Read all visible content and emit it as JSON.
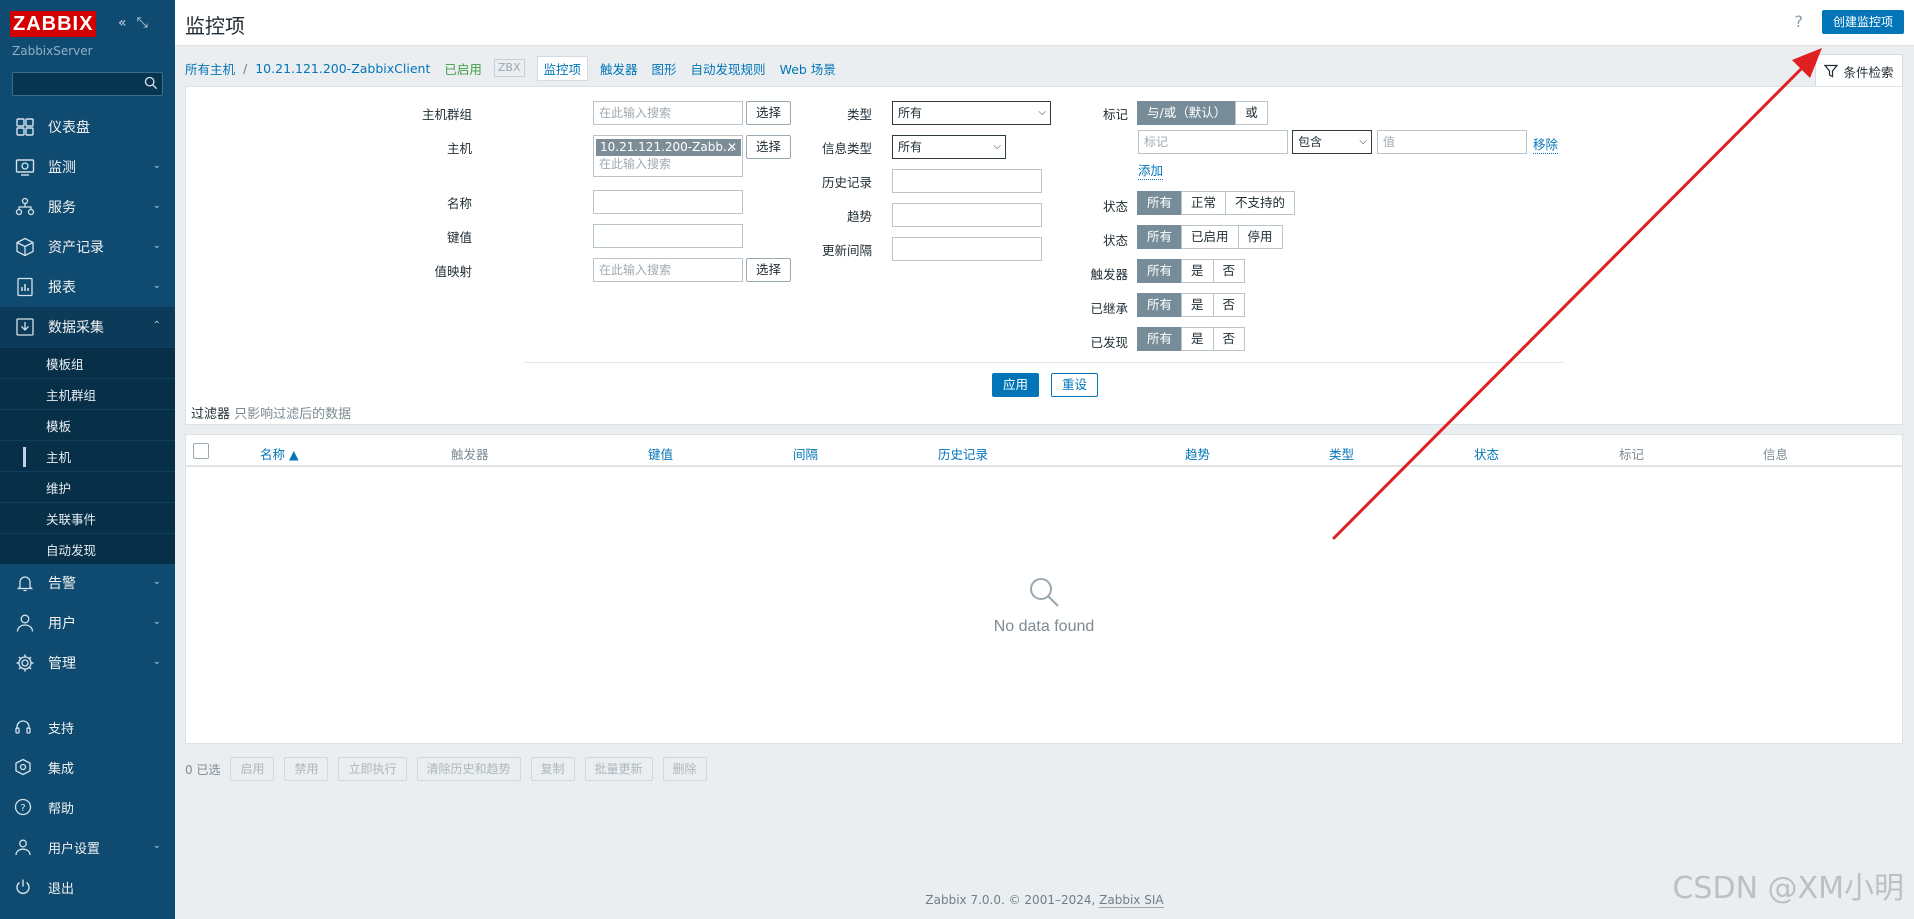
{
  "sidebar": {
    "logo": "ZABBIX",
    "server": "ZabbixServer",
    "main_items": [
      {
        "label": "仪表盘",
        "icon": "dashboard-icon"
      },
      {
        "label": "监测",
        "icon": "monitoring-icon"
      },
      {
        "label": "服务",
        "icon": "services-icon"
      },
      {
        "label": "资产记录",
        "icon": "inventory-icon"
      },
      {
        "label": "报表",
        "icon": "reports-icon"
      },
      {
        "label": "数据采集",
        "icon": "data-collection-icon"
      }
    ],
    "sub_items": [
      "模板组",
      "主机群组",
      "模板",
      "主机",
      "维护",
      "关联事件",
      "自动发现"
    ],
    "lower_items": [
      {
        "label": "告警",
        "icon": "alerts-icon"
      },
      {
        "label": "用户",
        "icon": "users-icon"
      },
      {
        "label": "管理",
        "icon": "admin-icon"
      }
    ],
    "bottom_items": [
      {
        "label": "支持",
        "icon": "support-icon"
      },
      {
        "label": "集成",
        "icon": "integrations-icon"
      },
      {
        "label": "帮助",
        "icon": "help-icon"
      },
      {
        "label": "用户设置",
        "icon": "user-settings-icon"
      },
      {
        "label": "退出",
        "icon": "signout-icon"
      }
    ]
  },
  "header": {
    "title": "监控项",
    "help": "?",
    "create_button": "创建监控项"
  },
  "breadcrumbs": {
    "all_hosts": "所有主机",
    "separator": "/",
    "host": "10.21.121.200-ZabbixClient",
    "enabled": "已启用",
    "zbx": "ZBX",
    "tabs": [
      "监控项",
      "触发器",
      "图形",
      "自动发现规则",
      "Web 场景"
    ]
  },
  "filter_tab": "条件检索",
  "filter": {
    "host_group_label": "主机群组",
    "host_label": "主机",
    "name_label": "名称",
    "key_label": "键值",
    "valuemap_label": "值映射",
    "search_placeholder": "在此输入搜索",
    "select_button": "选择",
    "host_chip": "10.21.121.200-Zabb...",
    "type_label": "类型",
    "type_value": "所有",
    "info_type_label": "信息类型",
    "info_type_value": "所有",
    "history_label": "历史记录",
    "trends_label": "趋势",
    "interval_label": "更新间隔",
    "tags_label": "标记",
    "tags_and_or": "与/或（默认）",
    "tags_or": "或",
    "tag_placeholder": "标记",
    "tag_operator": "包含",
    "tag_value_placeholder": "值",
    "remove": "移除",
    "add": "添加",
    "state_label": "状态",
    "state_options": [
      "所有",
      "正常",
      "不支持的"
    ],
    "status_label": "状态",
    "status_options": [
      "所有",
      "已启用",
      "停用"
    ],
    "triggers_label": "触发器",
    "inherited_label": "已继承",
    "discovered_label": "已发现",
    "yes_no_options": [
      "所有",
      "是",
      "否"
    ],
    "apply": "应用",
    "reset": "重设",
    "note_title": "过滤器",
    "note_text": "只影响过滤后的数据"
  },
  "table": {
    "columns": [
      "名称 ▲",
      "触发器",
      "键值",
      "间隔",
      "历史记录",
      "趋势",
      "类型",
      "状态",
      "标记",
      "信息"
    ],
    "empty_text": "No data found"
  },
  "actions": {
    "count": "0 已选",
    "buttons": [
      "启用",
      "禁用",
      "立即执行",
      "清除历史和趋势",
      "复制",
      "批量更新",
      "删除"
    ]
  },
  "footer": {
    "prefix": "Zabbix 7.0.0. © 2001–2024,",
    "company": "Zabbix SIA"
  },
  "watermark": "CSDN @XM小明",
  "colors": {
    "sidebar": "#0f4b70",
    "accent": "#0275b8",
    "logo": "#d40000",
    "annotation_arrow": "#e02020"
  }
}
